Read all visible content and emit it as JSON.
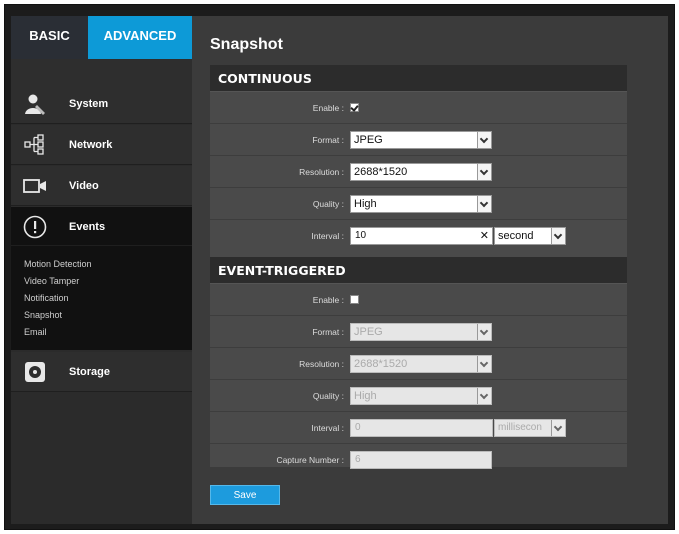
{
  "tabs": {
    "basic": "BASIC",
    "advanced": "ADVANCED"
  },
  "colors": {
    "accent": "#0d9ad7",
    "sidebar_active": "#111111",
    "panel": "#4a4a4a"
  },
  "nav": {
    "system": {
      "label": "System",
      "icon": "admin-user-icon"
    },
    "network": {
      "label": "Network",
      "icon": "network-tree-icon"
    },
    "video": {
      "label": "Video",
      "icon": "video-camera-icon"
    },
    "events": {
      "label": "Events",
      "icon": "exclamation-circle-icon"
    },
    "storage": {
      "label": "Storage",
      "icon": "disk-icon"
    },
    "events_sub": [
      "Motion Detection",
      "Video Tamper",
      "Notification",
      "Snapshot",
      "Email"
    ]
  },
  "main": {
    "title": "Snapshot",
    "continuous": {
      "header": "CONTINUOUS",
      "enable_label": "Enable :",
      "format_label": "Format :",
      "format_value": "JPEG",
      "resolution_label": "Resolution :",
      "resolution_value": "2688*1520",
      "quality_label": "Quality :",
      "quality_value": "High",
      "interval_label": "Interval :",
      "interval_value": "10",
      "interval_unit": "second"
    },
    "event_triggered": {
      "header": "EVENT-TRIGGERED",
      "enable_label": "Enable :",
      "format_label": "Format :",
      "format_value": "JPEG",
      "resolution_label": "Resolution :",
      "resolution_value": "2688*1520",
      "quality_label": "Quality :",
      "quality_value": "High",
      "interval_label": "Interval :",
      "interval_value": "0",
      "interval_unit": "millisecon",
      "capture_label": "Capture Number :",
      "capture_value": "6"
    },
    "save_label": "Save"
  }
}
